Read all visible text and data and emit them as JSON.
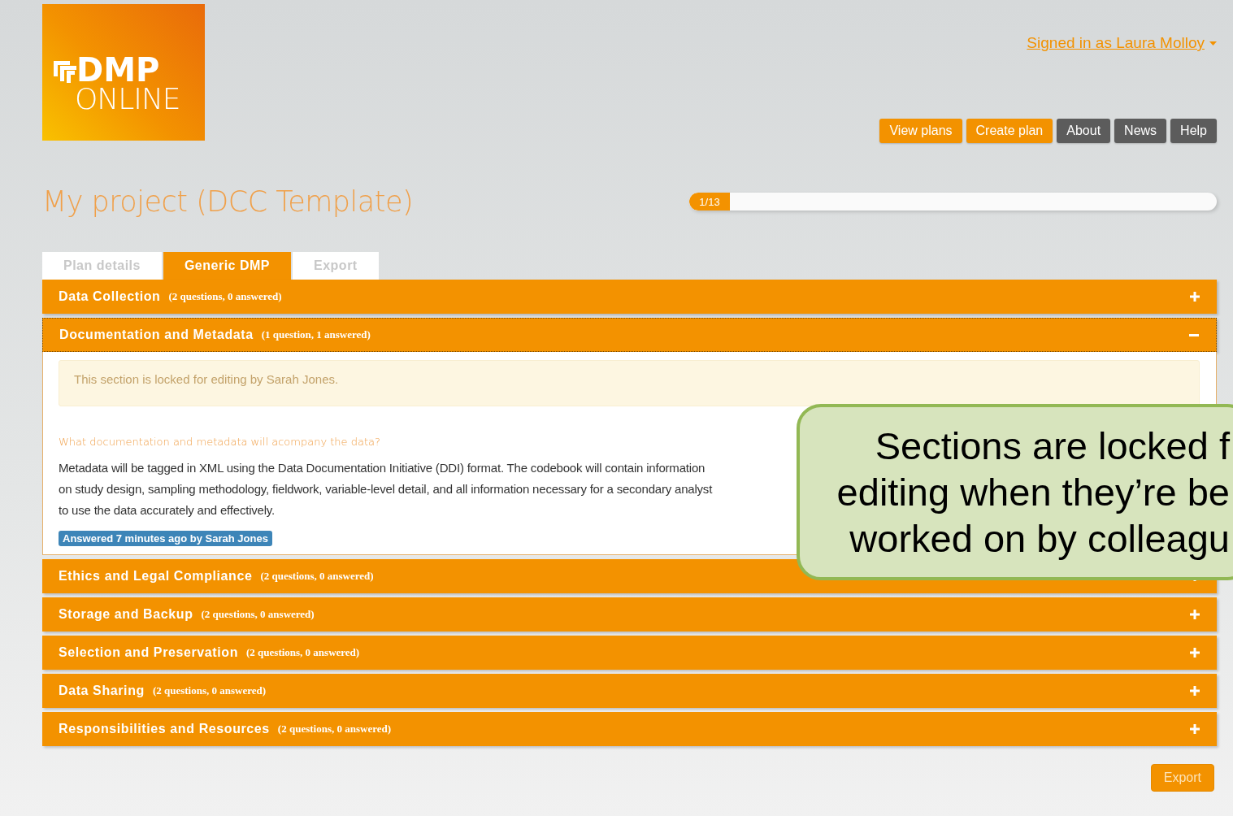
{
  "logo": {
    "line_1": "DMP",
    "line_2": "ONLINE"
  },
  "user_menu": {
    "label": "Signed in as Laura Molloy"
  },
  "nav": [
    {
      "label": "View plans",
      "kind": "primary"
    },
    {
      "label": "Create plan",
      "kind": "primary"
    },
    {
      "label": "About",
      "kind": "secondary"
    },
    {
      "label": "News",
      "kind": "secondary"
    },
    {
      "label": "Help",
      "kind": "secondary"
    }
  ],
  "title": "My project (DCC Template)",
  "progress": {
    "label": "1/13",
    "level": 0.077
  },
  "tabs": [
    {
      "label": "Plan details",
      "selected": false
    },
    {
      "label": "Generic DMP",
      "selected": true
    },
    {
      "label": "Export",
      "selected": false
    }
  ],
  "sections": [
    {
      "title": "Data Collection",
      "count": "(2 questions, 0 answered)",
      "expanded": false
    },
    {
      "title": "Documentation and Metadata",
      "count": "(1 question, 1 answered)",
      "expanded": true,
      "lock_notice": "This section is locked for editing by Sarah Jones.",
      "question": "What documentation and metadata will acompany the data?",
      "answer": "Metadata will be tagged in XML using the Data Documentation Initiative (DDI) format. The codebook will contain information on study design, sampling methodology, fieldwork, variable-level detail, and all information necessary for a secondary analyst to use the data accurately and effectively.",
      "answered_badge": "Answered 7 minutes ago by Sarah Jones"
    },
    {
      "title": "Ethics and Legal Compliance",
      "count": "(2 questions, 0 answered)",
      "expanded": false
    },
    {
      "title": "Storage and Backup",
      "count": "(2 questions, 0 answered)",
      "expanded": false
    },
    {
      "title": "Selection and Preservation",
      "count": "(2 questions, 0 answered)",
      "expanded": false
    },
    {
      "title": "Data Sharing",
      "count": "(2 questions, 0 answered)",
      "expanded": false
    },
    {
      "title": "Responsibilities and Resources",
      "count": "(2 questions, 0 answered)",
      "expanded": false
    }
  ],
  "export_button": "Export",
  "callout": {
    "lines": [
      "Sections are locked f",
      "editing when they’re be",
      "worked on by colleagu"
    ]
  }
}
